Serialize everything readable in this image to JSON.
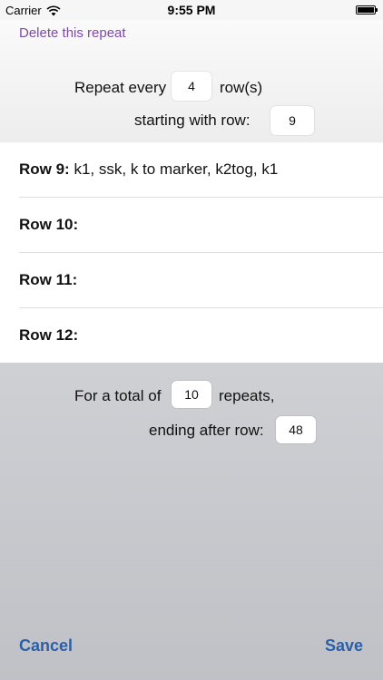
{
  "status_bar": {
    "carrier": "Carrier",
    "time": "9:55 PM"
  },
  "header": {
    "delete_label": "Delete this repeat",
    "repeat_every_label": "Repeat every",
    "repeat_every_value": "4",
    "rows_suffix": "row(s)",
    "starting_with_label": "starting with row:",
    "starting_with_value": "9"
  },
  "rows": [
    {
      "label": "Row 9:",
      "instruction": "k1, ssk, k to marker, k2tog, k1"
    },
    {
      "label": "Row 10:",
      "instruction": ""
    },
    {
      "label": "Row 11:",
      "instruction": ""
    },
    {
      "label": "Row 12:",
      "instruction": ""
    }
  ],
  "footer": {
    "total_label": "For a total of",
    "total_value": "10",
    "repeats_suffix": "repeats,",
    "ending_label": "ending after row:",
    "ending_value": "48",
    "cancel_label": "Cancel",
    "save_label": "Save"
  },
  "colors": {
    "delete_link": "#7d4ba8",
    "action_buttons": "#2d5fa6"
  }
}
